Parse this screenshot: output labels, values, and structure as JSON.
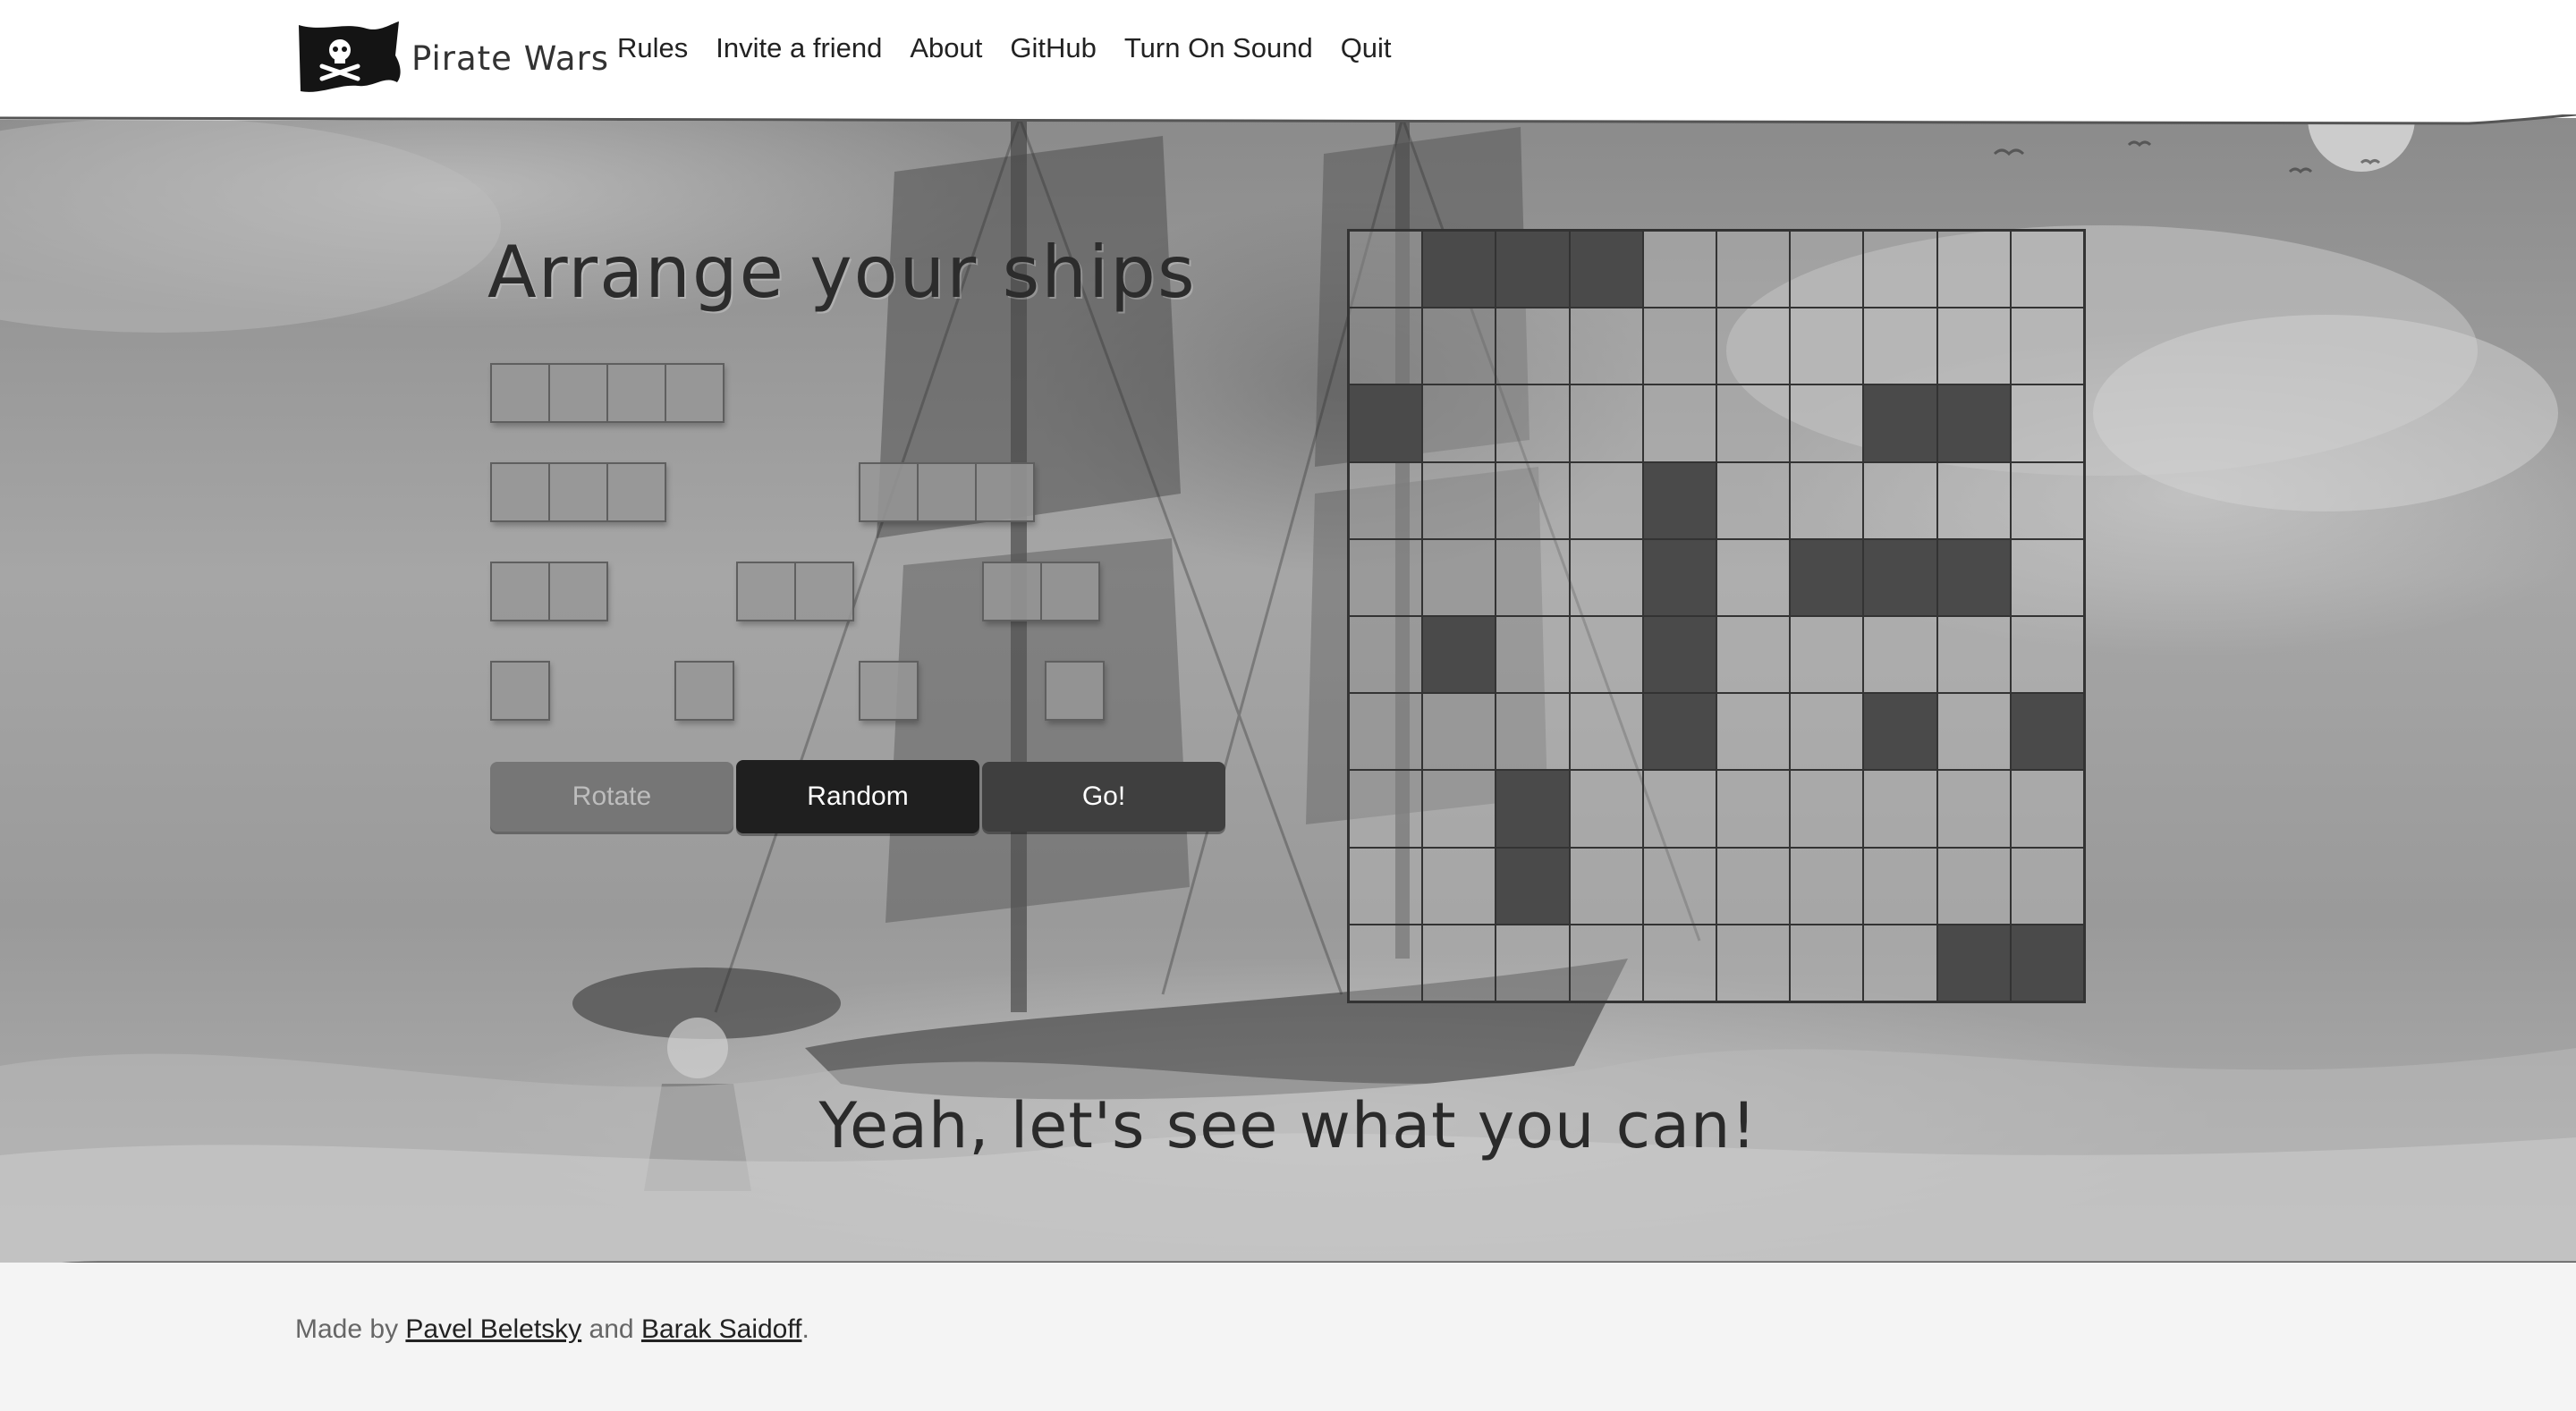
{
  "header": {
    "brand_name": "Pirate Wars",
    "nav": [
      "Rules",
      "Invite a friend",
      "About",
      "GitHub",
      "Turn On Sound",
      "Quit"
    ]
  },
  "main": {
    "title": "Arrange your ships",
    "buttons": {
      "rotate": "Rotate",
      "random": "Random",
      "go": "Go!"
    },
    "message": "Yeah, let's see what you can!"
  },
  "fleet": [
    {
      "name": "battleship",
      "length": 4
    },
    {
      "name": "cruiser-1",
      "length": 3
    },
    {
      "name": "cruiser-2",
      "length": 3
    },
    {
      "name": "destroyer-1",
      "length": 2
    },
    {
      "name": "destroyer-2",
      "length": 2
    },
    {
      "name": "destroyer-3",
      "length": 2
    },
    {
      "name": "submarine-1",
      "length": 1
    },
    {
      "name": "submarine-2",
      "length": 1
    },
    {
      "name": "submarine-3",
      "length": 1
    },
    {
      "name": "submarine-4",
      "length": 1
    }
  ],
  "board": {
    "size": 10,
    "cells": [
      "0111000000",
      "0000000000",
      "1000000110",
      "0000100000",
      "0000101110",
      "0100100000",
      "0000100101",
      "0010000000",
      "0010000000",
      "0000000011"
    ]
  },
  "footer": {
    "prefix": "Made by",
    "author1": "Pavel Beletsky",
    "conjunction": "and",
    "author2": "Barak Saidoff",
    "suffix": "."
  },
  "colors": {
    "header_bg": "#ffffff",
    "placed_cell": "#4a4a4a",
    "random_button": "#1f1f1f",
    "go_button": "#3f3f3f",
    "rotate_button": "#767676"
  }
}
